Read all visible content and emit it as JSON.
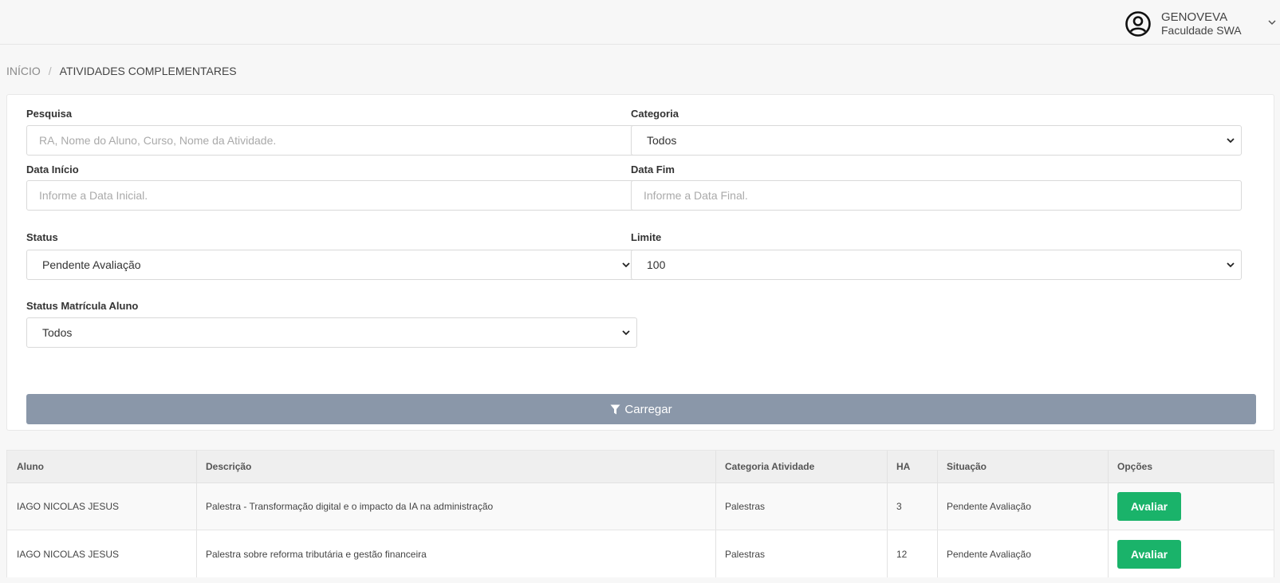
{
  "header": {
    "user_name": "GENOVEVA",
    "organization": "Faculdade SWA",
    "icons": {
      "avatar": "user-circle-icon",
      "menu": "chevron-down-icon"
    }
  },
  "breadcrumb": {
    "home": "INÍCIO",
    "separator": "/",
    "current": "ATIVIDADES COMPLEMENTARES"
  },
  "filters": {
    "search": {
      "label": "Pesquisa",
      "placeholder": "RA, Nome do Aluno, Curso, Nome da Atividade."
    },
    "category": {
      "label": "Categoria",
      "value": "Todos"
    },
    "start_date": {
      "label": "Data Início",
      "placeholder": "Informe a Data Inicial."
    },
    "end_date": {
      "label": "Data Fim",
      "placeholder": "Informe a Data Final."
    },
    "status": {
      "label": "Status",
      "value": "Pendente Avaliação"
    },
    "limit": {
      "label": "Limite",
      "value": "100"
    },
    "enrollment_status": {
      "label": "Status Matrícula Aluno",
      "value": "Todos"
    },
    "load_button": {
      "label": "Carregar",
      "icon": "filter-icon"
    }
  },
  "colors": {
    "load_button": "#8a97a9",
    "evaluate_button": "#1ab36a"
  },
  "table": {
    "columns": [
      "Aluno",
      "Descrição",
      "Categoria Atividade",
      "HA",
      "Situação",
      "Opções"
    ],
    "rows": [
      {
        "student": "IAGO NICOLAS JESUS",
        "description": "Palestra - Transformação digital e o impacto da IA na administração",
        "category": "Palestras",
        "ha": "3",
        "status": "Pendente Avaliação",
        "action": "Avaliar"
      },
      {
        "student": "IAGO NICOLAS JESUS",
        "description": "Palestra sobre reforma tributária e gestão financeira",
        "category": "Palestras",
        "ha": "12",
        "status": "Pendente Avaliação",
        "action": "Avaliar"
      }
    ]
  }
}
